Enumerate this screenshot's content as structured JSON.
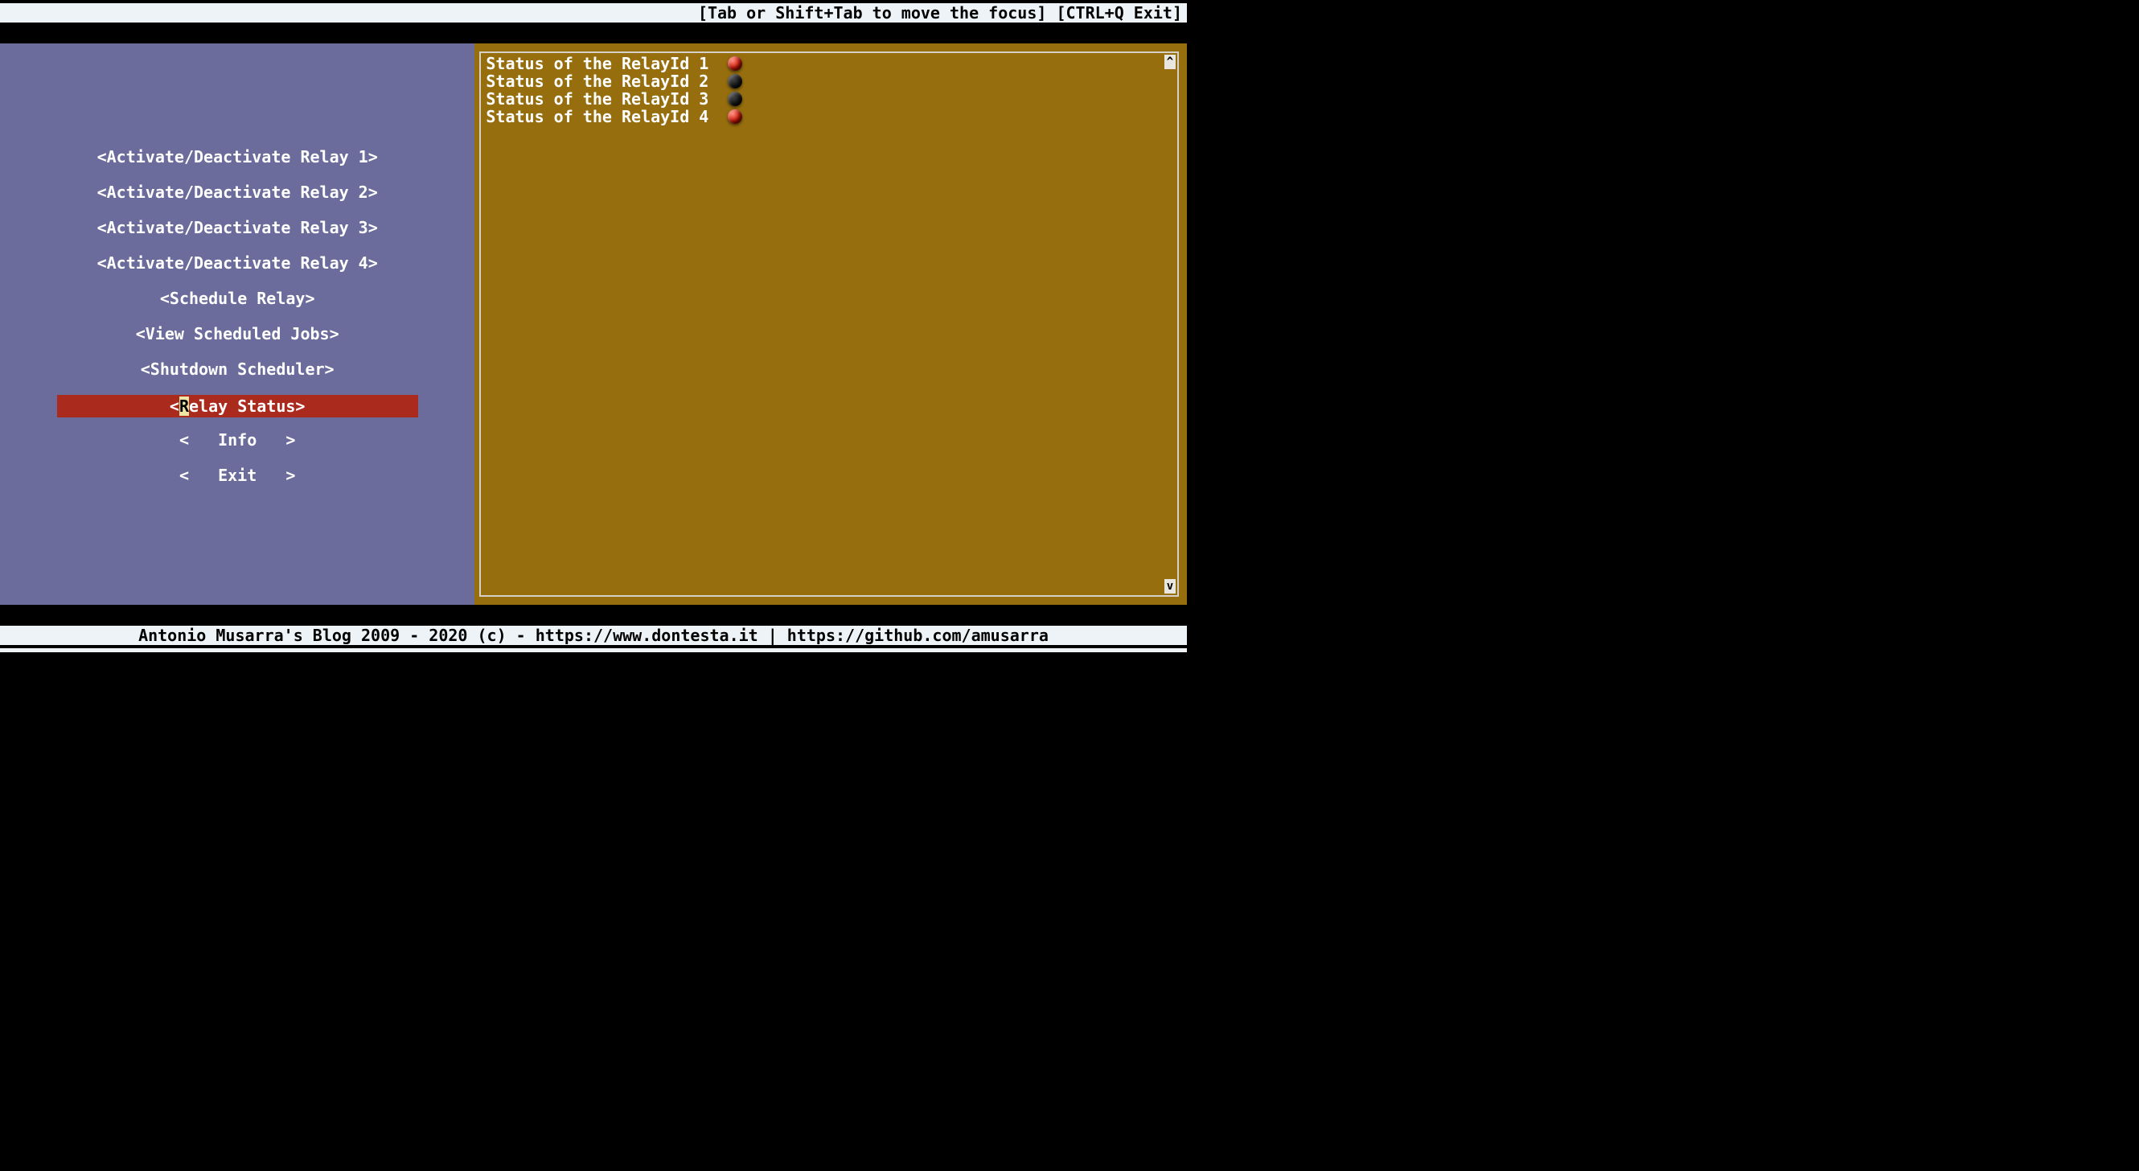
{
  "top_bar": {
    "hint": "[Tab or Shift+Tab to move the focus] [CTRL+Q Exit]"
  },
  "menu": {
    "items": [
      {
        "label": "<Activate/Deactivate Relay 1>",
        "selected": false
      },
      {
        "label": "<Activate/Deactivate Relay 2>",
        "selected": false
      },
      {
        "label": "<Activate/Deactivate Relay 3>",
        "selected": false
      },
      {
        "label": "<Activate/Deactivate Relay 4>",
        "selected": false
      },
      {
        "label": "<Schedule Relay>",
        "selected": false
      },
      {
        "label": "<View Scheduled Jobs>",
        "selected": false
      },
      {
        "label": "<Shutdown Scheduler>",
        "selected": false
      },
      {
        "label_pre": "<",
        "hotkey": "R",
        "label_post": "elay Status>",
        "selected": true
      },
      {
        "label": "<   Info   >",
        "selected": false
      },
      {
        "label": "<   Exit   >",
        "selected": false
      }
    ]
  },
  "status": {
    "lines": [
      {
        "text": "Status of the RelayId 1 ",
        "led": "red"
      },
      {
        "text": "Status of the RelayId 2 ",
        "led": "off"
      },
      {
        "text": "Status of the RelayId 3 ",
        "led": "off"
      },
      {
        "text": "Status of the RelayId 4 ",
        "led": "red"
      }
    ],
    "scroll_up": "^",
    "scroll_down": "v"
  },
  "bottom_bar": {
    "text": "Antonio Musarra's Blog 2009 - 2020 (c) - https://www.dontesta.it | https://github.com/amusarra"
  }
}
